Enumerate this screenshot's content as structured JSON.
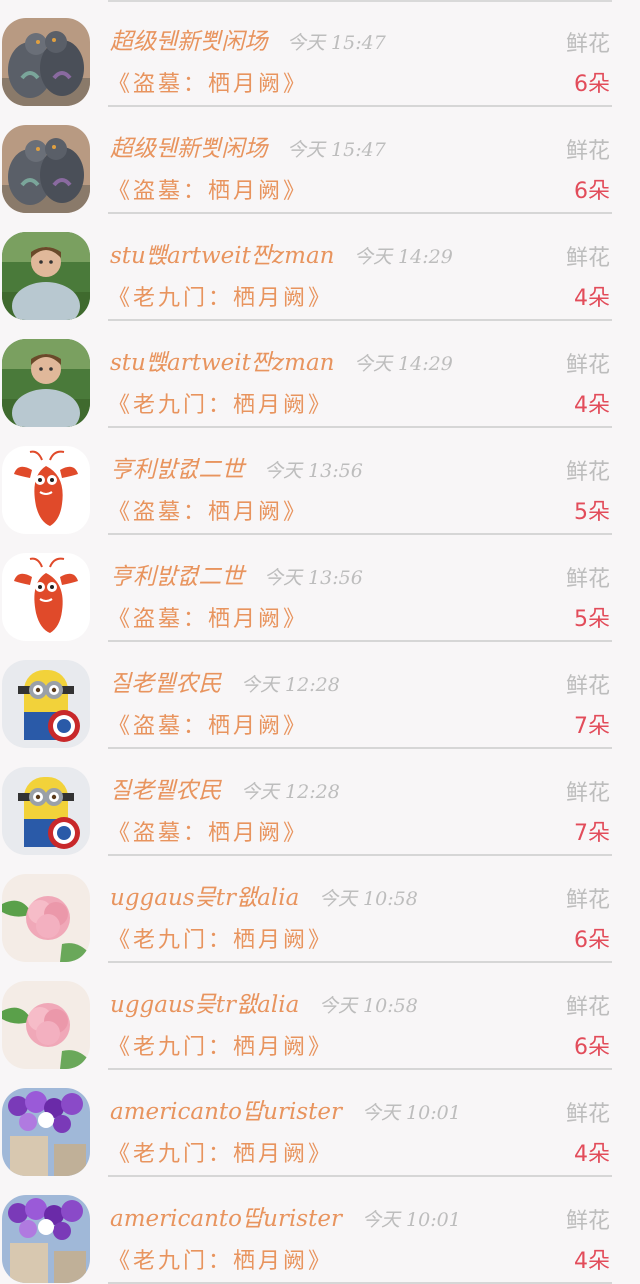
{
  "rows": [
    {
      "name": "超级뒌新뾧闲场",
      "time": "今天 15:47",
      "gift": "鲜花",
      "book": "《盗墓：栖月阙》",
      "count": "6朵",
      "avatar": "pigeons-avatar"
    },
    {
      "name": "超级뒌新뾧闲场",
      "time": "今天 15:47",
      "gift": "鲜花",
      "book": "《盗墓：栖月阙》",
      "count": "6朵",
      "avatar": "pigeons-avatar"
    },
    {
      "name": "stu뺁artweit짠zman",
      "time": "今天 14:29",
      "gift": "鲜花",
      "book": "《老九门：栖月阙》",
      "count": "4朵",
      "avatar": "boy-avatar"
    },
    {
      "name": "stu뺁artweit짠zman",
      "time": "今天 14:29",
      "gift": "鲜花",
      "book": "《老九门：栖月阙》",
      "count": "4朵",
      "avatar": "boy-avatar"
    },
    {
      "name": "亨利밠켮二世",
      "time": "今天 13:56",
      "gift": "鲜花",
      "book": "《盗墓：栖月阙》",
      "count": "5朵",
      "avatar": "lobster-avatar"
    },
    {
      "name": "亨利밠켮二世",
      "time": "今天 13:56",
      "gift": "鲜花",
      "book": "《盗墓：栖月阙》",
      "count": "5朵",
      "avatar": "lobster-avatar"
    },
    {
      "name": "질老뮅农民",
      "time": "今天 12:28",
      "gift": "鲜花",
      "book": "《盗墓：栖月阙》",
      "count": "7朵",
      "avatar": "minion-avatar"
    },
    {
      "name": "질老뮅农民",
      "time": "今天 12:28",
      "gift": "鲜花",
      "book": "《盗墓：栖月阙》",
      "count": "7朵",
      "avatar": "minion-avatar"
    },
    {
      "name": "uggaus믖tr왮alia",
      "time": "今天 10:58",
      "gift": "鲜花",
      "book": "《老九门：栖月阙》",
      "count": "6朵",
      "avatar": "carnation-avatar"
    },
    {
      "name": "uggaus믖tr왮alia",
      "time": "今天 10:58",
      "gift": "鲜花",
      "book": "《老九门：栖月阙》",
      "count": "6朵",
      "avatar": "carnation-avatar"
    },
    {
      "name": "americanto땁urister",
      "time": "今天 10:01",
      "gift": "鲜花",
      "book": "《老九门：栖月阙》",
      "count": "4朵",
      "avatar": "balloons-avatar"
    },
    {
      "name": "americanto땁urister",
      "time": "今天 10:01",
      "gift": "鲜花",
      "book": "《老九门：栖月阙》",
      "count": "4朵",
      "avatar": "balloons-avatar"
    }
  ]
}
